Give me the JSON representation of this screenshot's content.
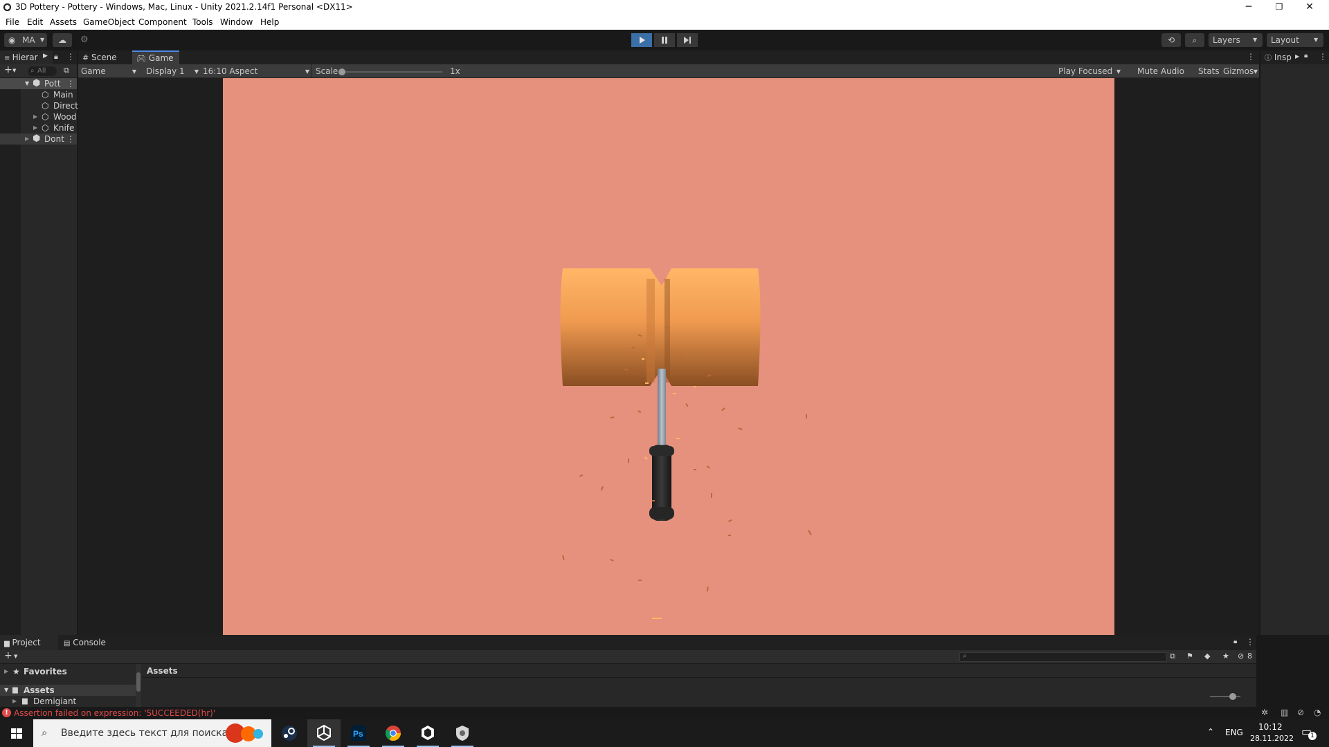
{
  "window": {
    "title": "3D Pottery - Pottery - Windows, Mac, Linux - Unity 2021.2.14f1 Personal <DX11>",
    "minimize": "─",
    "restore": "❐",
    "close": "✕"
  },
  "menu": [
    "File",
    "Edit",
    "Assets",
    "GameObject",
    "Component",
    "Tools",
    "Window",
    "Help"
  ],
  "toolbar": {
    "account": "MA",
    "layers_label": "Layers",
    "layout_label": "Layout",
    "accent_color": "#3a6fa8"
  },
  "hierarchy": {
    "tab_label": "Hierar",
    "search_placeholder": "All",
    "items": [
      {
        "label": "Pott",
        "depth": 0,
        "selected": true,
        "expanded": true
      },
      {
        "label": "Main",
        "depth": 1
      },
      {
        "label": "Direct",
        "depth": 1
      },
      {
        "label": "Wood",
        "depth": 1
      },
      {
        "label": "Knife",
        "depth": 1
      },
      {
        "label": "Dont",
        "depth": 0,
        "selected": true
      }
    ]
  },
  "game_view": {
    "tabs": [
      {
        "label": "Scene",
        "icon": "grid-icon"
      },
      {
        "label": "Game",
        "icon": "gamepad-icon",
        "active": true
      }
    ],
    "view_select": "Game",
    "display_select": "Display 1",
    "aspect_select": "16:10 Aspect",
    "scale_label": "Scale",
    "scale_value": "1x",
    "play_mode": "Play Focused",
    "mute_audio": "Mute Audio",
    "stats": "Stats",
    "gizmos": "Gizmos",
    "background_color": "#e5917d",
    "pottery_color": "#f0a055"
  },
  "inspector": {
    "tab_label": "Insp"
  },
  "bottom_panel": {
    "tabs": [
      {
        "label": "Project",
        "icon": "folder-icon",
        "active": true
      },
      {
        "label": "Console",
        "icon": "console-icon"
      }
    ],
    "favorites_label": "Favorites",
    "assets_label": "Assets",
    "assets_child": "Demigiant",
    "breadcrumb": "Assets",
    "hidden_count": "8"
  },
  "status": {
    "message": "Assertion failed on expression: 'SUCCEEDED(hr)'",
    "color": "#e04a4a"
  },
  "taskbar": {
    "search_placeholder": "Введите здесь текст для поиска",
    "language": "ENG",
    "time": "10:12",
    "date": "28.11.2022",
    "notification_count": "1"
  }
}
